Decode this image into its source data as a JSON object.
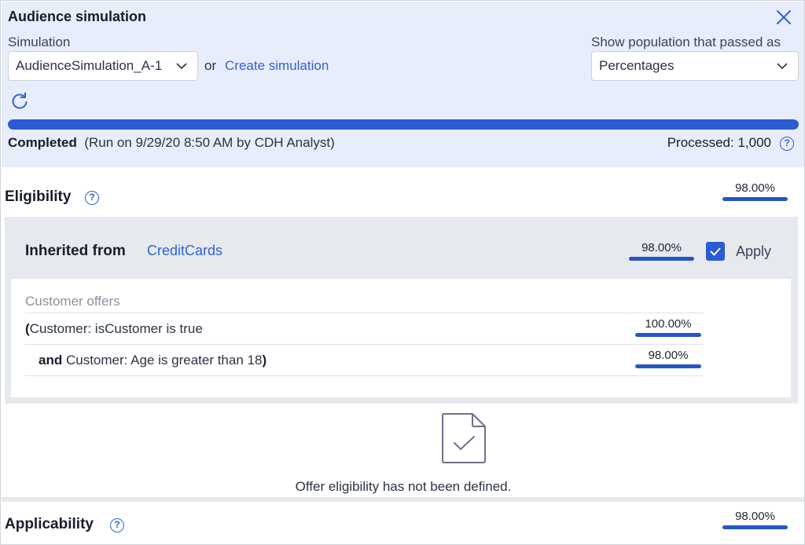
{
  "header": {
    "title": "Audience simulation",
    "close_icon": "close-icon",
    "simulation": {
      "label": "Simulation",
      "selected": "AudienceSimulation_A-1",
      "or_text": "or",
      "create_link": "Create simulation"
    },
    "population": {
      "label": "Show population that passed as",
      "selected": "Percentages"
    },
    "refresh_icon": "refresh-icon",
    "progress_percent": 100,
    "status": {
      "state": "Completed",
      "detail": "(Run on 9/29/20 8:50 AM by CDH Analyst)",
      "processed": "Processed: 1,000"
    },
    "accent_color": "#2a5bd3"
  },
  "eligibility": {
    "title": "Eligibility",
    "percent": "98.00%",
    "inherited": {
      "label": "Inherited from",
      "link": "CreditCards",
      "percent": "98.00%",
      "apply_label": "Apply",
      "apply_checked": true,
      "rules": {
        "heading": "Customer offers",
        "rows": [
          {
            "prefix": "(",
            "connector": "",
            "text": "Customer: isCustomer is true",
            "suffix": "",
            "percent": "100.00%"
          },
          {
            "prefix": "",
            "connector": "and",
            "text": " Customer: Age is greater than 18",
            "suffix": ")",
            "percent": "98.00%"
          }
        ]
      }
    },
    "empty_state": "Offer eligibility has not been defined."
  },
  "applicability": {
    "title": "Applicability",
    "percent": "98.00%"
  },
  "help_glyph": "?"
}
